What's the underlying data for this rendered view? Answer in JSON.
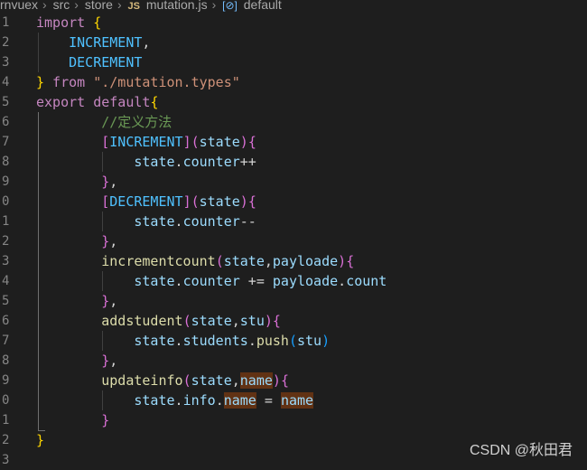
{
  "breadcrumb": {
    "items": [
      "rnvuex",
      "src",
      "store"
    ],
    "file_badge": "JS",
    "file": "mutation.js",
    "symbol_icon": "symbol-variable-icon",
    "symbol": "default"
  },
  "gutter": [
    "1",
    "2",
    "3",
    "4",
    "5",
    "6",
    "7",
    "8",
    "9",
    "0",
    "1",
    "2",
    "3",
    "4",
    "5",
    "6",
    "7",
    "8",
    "9",
    "0",
    "1",
    "2",
    "3"
  ],
  "code": [
    [
      [
        "kw",
        "import"
      ],
      [
        "op",
        " "
      ],
      [
        "pn",
        "{"
      ]
    ],
    [
      [
        "cn",
        "    INCREMENT"
      ],
      [
        "op",
        ","
      ]
    ],
    [
      [
        "cn",
        "    DECREMENT"
      ]
    ],
    [
      [
        "pn",
        "}"
      ],
      [
        "kw",
        " from"
      ],
      [
        "op",
        " "
      ],
      [
        "st",
        "\"./mutation.types\""
      ]
    ],
    [
      [
        "kw",
        "export"
      ],
      [
        "op",
        " "
      ],
      [
        "kw",
        "default"
      ],
      [
        "pn",
        "{"
      ]
    ],
    [
      [
        "cm",
        "        //定义方法"
      ]
    ],
    [
      [
        "op",
        "        "
      ],
      [
        "pu",
        "["
      ],
      [
        "cn",
        "INCREMENT"
      ],
      [
        "pu",
        "]"
      ],
      [
        "pu",
        "("
      ],
      [
        "vr",
        "state"
      ],
      [
        "pu",
        ")"
      ],
      [
        "pu",
        "{"
      ]
    ],
    [
      [
        "op",
        "            "
      ],
      [
        "vr",
        "state"
      ],
      [
        "op",
        "."
      ],
      [
        "vr",
        "counter"
      ],
      [
        "op",
        "++"
      ]
    ],
    [
      [
        "op",
        "        "
      ],
      [
        "pu",
        "}"
      ],
      [
        "op",
        ","
      ]
    ],
    [
      [
        "op",
        "        "
      ],
      [
        "pu",
        "["
      ],
      [
        "cn",
        "DECREMENT"
      ],
      [
        "pu",
        "]"
      ],
      [
        "pu",
        "("
      ],
      [
        "vr",
        "state"
      ],
      [
        "pu",
        ")"
      ],
      [
        "pu",
        "{"
      ]
    ],
    [
      [
        "op",
        "            "
      ],
      [
        "vr",
        "state"
      ],
      [
        "op",
        "."
      ],
      [
        "vr",
        "counter"
      ],
      [
        "op",
        "--"
      ]
    ],
    [
      [
        "op",
        "        "
      ],
      [
        "pu",
        "}"
      ],
      [
        "op",
        ","
      ]
    ],
    [
      [
        "op",
        "        "
      ],
      [
        "fn",
        "incrementcount"
      ],
      [
        "pu",
        "("
      ],
      [
        "vr",
        "state"
      ],
      [
        "op",
        ","
      ],
      [
        "vr",
        "payloade"
      ],
      [
        "pu",
        ")"
      ],
      [
        "pu",
        "{"
      ]
    ],
    [
      [
        "op",
        "            "
      ],
      [
        "vr",
        "state"
      ],
      [
        "op",
        "."
      ],
      [
        "vr",
        "counter"
      ],
      [
        "op",
        " += "
      ],
      [
        "vr",
        "payloade"
      ],
      [
        "op",
        "."
      ],
      [
        "vr",
        "count"
      ]
    ],
    [
      [
        "op",
        "        "
      ],
      [
        "pu",
        "}"
      ],
      [
        "op",
        ","
      ]
    ],
    [
      [
        "op",
        "        "
      ],
      [
        "fn",
        "addstudent"
      ],
      [
        "pu",
        "("
      ],
      [
        "vr",
        "state"
      ],
      [
        "op",
        ","
      ],
      [
        "vr",
        "stu"
      ],
      [
        "pu",
        ")"
      ],
      [
        "pu",
        "{"
      ]
    ],
    [
      [
        "op",
        "            "
      ],
      [
        "vr",
        "state"
      ],
      [
        "op",
        "."
      ],
      [
        "vr",
        "students"
      ],
      [
        "op",
        "."
      ],
      [
        "fn",
        "push"
      ],
      [
        "pb",
        "("
      ],
      [
        "vr",
        "stu"
      ],
      [
        "pb",
        ")"
      ]
    ],
    [
      [
        "op",
        "        "
      ],
      [
        "pu",
        "}"
      ],
      [
        "op",
        ","
      ]
    ],
    [
      [
        "op",
        "        "
      ],
      [
        "fn",
        "updateinfo"
      ],
      [
        "pu",
        "("
      ],
      [
        "vr",
        "state"
      ],
      [
        "op",
        ","
      ],
      [
        "vr hl",
        "name"
      ],
      [
        "pu",
        ")"
      ],
      [
        "pu",
        "{"
      ]
    ],
    [
      [
        "op",
        "            "
      ],
      [
        "vr",
        "state"
      ],
      [
        "op",
        "."
      ],
      [
        "vr",
        "info"
      ],
      [
        "op",
        "."
      ],
      [
        "vr hl",
        "name"
      ],
      [
        "op",
        " = "
      ],
      [
        "vr hl",
        "name"
      ]
    ],
    [
      [
        "op",
        "        "
      ],
      [
        "pu",
        "}"
      ]
    ],
    [
      [
        "pn",
        "}"
      ]
    ],
    [
      [
        "op",
        ""
      ]
    ]
  ],
  "watermark": "CSDN @秋田君"
}
